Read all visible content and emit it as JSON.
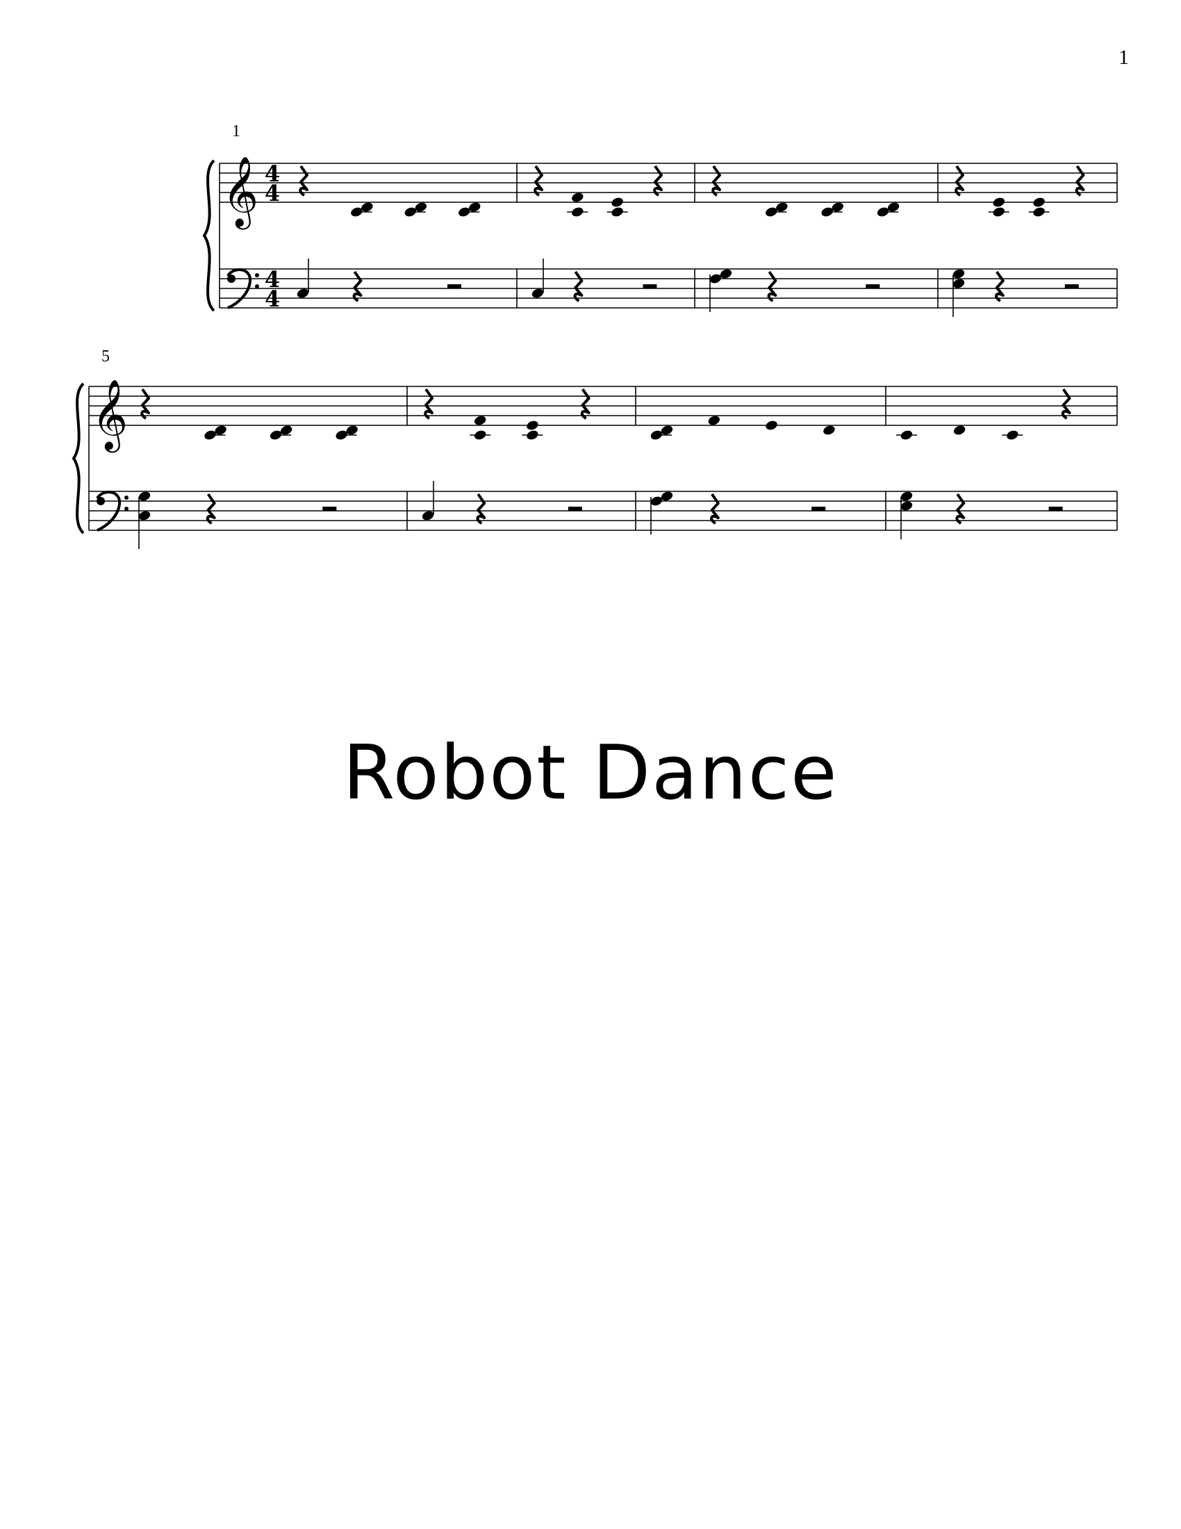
{
  "page_number": "1",
  "title": "Robot Dance",
  "time_signature": {
    "numerator": "4",
    "denominator": "4"
  },
  "clefs": {
    "treble": "treble-clef-icon",
    "bass": "bass-clef-icon"
  },
  "systems": [
    {
      "start_measure": "1",
      "measures": [
        {
          "treble": [
            {
              "t": "rest",
              "d": "q"
            },
            {
              "t": "chord",
              "d": "q",
              "n": [
                "C4",
                "D4"
              ]
            },
            {
              "t": "chord",
              "d": "q",
              "n": [
                "C4",
                "D4"
              ]
            },
            {
              "t": "chord",
              "d": "q",
              "n": [
                "C4",
                "D4"
              ]
            }
          ],
          "bass": [
            {
              "t": "note",
              "d": "q",
              "n": [
                "C3"
              ],
              "stem": "up"
            },
            {
              "t": "rest",
              "d": "q"
            },
            {
              "t": "rest",
              "d": "h"
            }
          ]
        },
        {
          "treble": [
            {
              "t": "rest",
              "d": "q"
            },
            {
              "t": "chord",
              "d": "q",
              "n": [
                "C4",
                "F4"
              ]
            },
            {
              "t": "chord",
              "d": "q",
              "n": [
                "C4",
                "E4"
              ]
            },
            {
              "t": "rest",
              "d": "q"
            }
          ],
          "bass": [
            {
              "t": "note",
              "d": "q",
              "n": [
                "C3"
              ],
              "stem": "up"
            },
            {
              "t": "rest",
              "d": "q"
            },
            {
              "t": "rest",
              "d": "h"
            }
          ]
        },
        {
          "treble": [
            {
              "t": "rest",
              "d": "q"
            },
            {
              "t": "chord",
              "d": "q",
              "n": [
                "C4",
                "D4"
              ]
            },
            {
              "t": "chord",
              "d": "q",
              "n": [
                "C4",
                "D4"
              ]
            },
            {
              "t": "chord",
              "d": "q",
              "n": [
                "C4",
                "D4"
              ]
            }
          ],
          "bass": [
            {
              "t": "chord",
              "d": "q",
              "n": [
                "F3",
                "G3"
              ],
              "stem": "down"
            },
            {
              "t": "rest",
              "d": "q"
            },
            {
              "t": "rest",
              "d": "h"
            }
          ]
        },
        {
          "treble": [
            {
              "t": "rest",
              "d": "q"
            },
            {
              "t": "chord",
              "d": "q",
              "n": [
                "C4",
                "E4"
              ]
            },
            {
              "t": "chord",
              "d": "q",
              "n": [
                "C4",
                "E4"
              ]
            },
            {
              "t": "rest",
              "d": "q"
            }
          ],
          "bass": [
            {
              "t": "chord",
              "d": "q",
              "n": [
                "E3",
                "G3"
              ],
              "stem": "down"
            },
            {
              "t": "rest",
              "d": "q"
            },
            {
              "t": "rest",
              "d": "h"
            }
          ]
        }
      ]
    },
    {
      "start_measure": "5",
      "measures": [
        {
          "treble": [
            {
              "t": "rest",
              "d": "q"
            },
            {
              "t": "chord",
              "d": "q",
              "n": [
                "C4",
                "D4"
              ]
            },
            {
              "t": "chord",
              "d": "q",
              "n": [
                "C4",
                "D4"
              ]
            },
            {
              "t": "chord",
              "d": "q",
              "n": [
                "C4",
                "D4"
              ]
            }
          ],
          "bass": [
            {
              "t": "chord",
              "d": "q",
              "n": [
                "C3",
                "G3"
              ],
              "stem": "down"
            },
            {
              "t": "rest",
              "d": "q"
            },
            {
              "t": "rest",
              "d": "h"
            }
          ]
        },
        {
          "treble": [
            {
              "t": "rest",
              "d": "q"
            },
            {
              "t": "chord",
              "d": "q",
              "n": [
                "C4",
                "F4"
              ]
            },
            {
              "t": "chord",
              "d": "q",
              "n": [
                "C4",
                "E4"
              ]
            },
            {
              "t": "rest",
              "d": "q"
            }
          ],
          "bass": [
            {
              "t": "note",
              "d": "q",
              "n": [
                "C3"
              ],
              "stem": "up"
            },
            {
              "t": "rest",
              "d": "q"
            },
            {
              "t": "rest",
              "d": "h"
            }
          ]
        },
        {
          "treble": [
            {
              "t": "chord",
              "d": "q",
              "n": [
                "C4",
                "D4"
              ]
            },
            {
              "t": "note",
              "d": "q",
              "n": [
                "F4"
              ]
            },
            {
              "t": "note",
              "d": "q",
              "n": [
                "E4"
              ]
            },
            {
              "t": "note",
              "d": "q",
              "n": [
                "D4"
              ]
            }
          ],
          "bass": [
            {
              "t": "chord",
              "d": "q",
              "n": [
                "F3",
                "G3"
              ],
              "stem": "down"
            },
            {
              "t": "rest",
              "d": "q"
            },
            {
              "t": "rest",
              "d": "h"
            }
          ]
        },
        {
          "treble": [
            {
              "t": "note",
              "d": "q",
              "n": [
                "C4"
              ]
            },
            {
              "t": "note",
              "d": "q",
              "n": [
                "D4"
              ]
            },
            {
              "t": "note",
              "d": "q",
              "n": [
                "C4"
              ]
            },
            {
              "t": "rest",
              "d": "q"
            }
          ],
          "bass": [
            {
              "t": "chord",
              "d": "q",
              "n": [
                "E3",
                "G3"
              ],
              "stem": "down"
            },
            {
              "t": "rest",
              "d": "q"
            },
            {
              "t": "rest",
              "d": "h"
            }
          ]
        }
      ]
    }
  ]
}
